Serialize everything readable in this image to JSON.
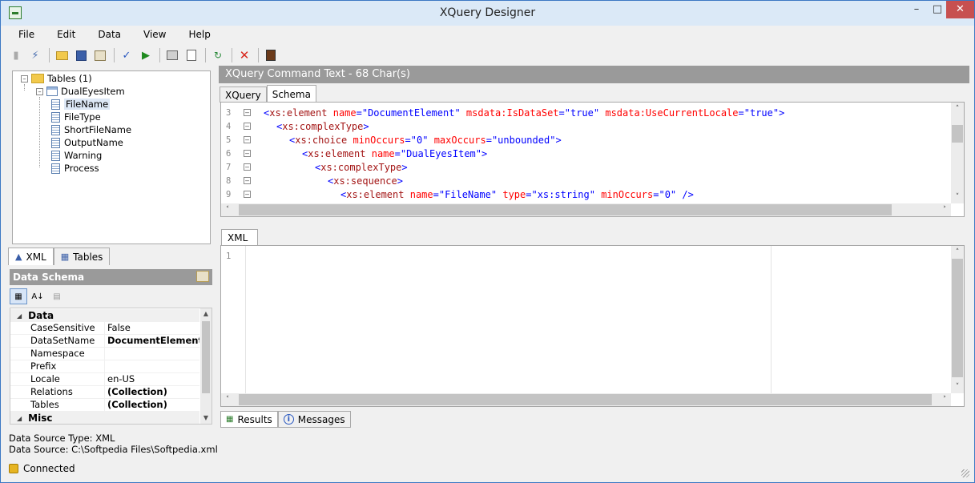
{
  "window": {
    "title": "XQuery Designer"
  },
  "menu": {
    "items": [
      "File",
      "Edit",
      "Data",
      "View",
      "Help"
    ]
  },
  "toolbar": {
    "icons": [
      "connect-icon",
      "disconnect-icon",
      "open-icon",
      "save-icon",
      "properties-icon",
      "validate-icon",
      "run-icon",
      "print-icon",
      "print-preview-icon",
      "refresh-icon",
      "delete-icon",
      "export-icon"
    ]
  },
  "tree": {
    "root": "Tables (1)",
    "table": "DualEyesItem",
    "columns": [
      "FileName",
      "FileType",
      "ShortFileName",
      "OutputName",
      "Warning",
      "Process"
    ],
    "selected": "FileName"
  },
  "left_tabs": {
    "xml": "XML",
    "tables": "Tables"
  },
  "schema_panel": {
    "title": "Data Schema",
    "categories": {
      "data": "Data",
      "misc": "Misc"
    },
    "properties": [
      {
        "name": "CaseSensitive",
        "value": "False",
        "bold": false
      },
      {
        "name": "DataSetName",
        "value": "DocumentElement",
        "bold": true
      },
      {
        "name": "Namespace",
        "value": "",
        "bold": false
      },
      {
        "name": "Prefix",
        "value": "",
        "bold": false
      },
      {
        "name": "Locale",
        "value": "en-US",
        "bold": false
      },
      {
        "name": "Relations",
        "value": "(Collection)",
        "bold": true
      },
      {
        "name": "Tables",
        "value": "(Collection)",
        "bold": true
      }
    ]
  },
  "status": {
    "source_type": "Data Source Type: XML",
    "source": "Data Source: C:\\Softpedia Files\\Softpedia.xml",
    "connection": "Connected"
  },
  "command": {
    "header": "XQuery Command Text - 68 Char(s)",
    "tabs": {
      "xquery": "XQuery",
      "schema": "Schema"
    },
    "lines": [
      {
        "n": "3",
        "indent": 0,
        "parts": [
          [
            "br",
            "<"
          ],
          [
            "tag",
            "xs:element"
          ],
          [
            "sp",
            " "
          ],
          [
            "attr",
            "name"
          ],
          [
            "br",
            "="
          ],
          [
            "val",
            "\"DocumentElement\""
          ],
          [
            "sp",
            " "
          ],
          [
            "attr",
            "msdata:IsDataSet"
          ],
          [
            "br",
            "="
          ],
          [
            "val",
            "\"true\""
          ],
          [
            "sp",
            " "
          ],
          [
            "attr",
            "msdata:UseCurrentLocale"
          ],
          [
            "br",
            "="
          ],
          [
            "val",
            "\"true\""
          ],
          [
            "br",
            ">"
          ]
        ]
      },
      {
        "n": "4",
        "indent": 1,
        "parts": [
          [
            "br",
            "<"
          ],
          [
            "tag",
            "xs:complexType"
          ],
          [
            "br",
            ">"
          ]
        ]
      },
      {
        "n": "5",
        "indent": 2,
        "parts": [
          [
            "br",
            "<"
          ],
          [
            "tag",
            "xs:choice"
          ],
          [
            "sp",
            " "
          ],
          [
            "attr",
            "minOccurs"
          ],
          [
            "br",
            "="
          ],
          [
            "val",
            "\"0\""
          ],
          [
            "sp",
            " "
          ],
          [
            "attr",
            "maxOccurs"
          ],
          [
            "br",
            "="
          ],
          [
            "val",
            "\"unbounded\""
          ],
          [
            "br",
            ">"
          ]
        ]
      },
      {
        "n": "6",
        "indent": 3,
        "parts": [
          [
            "br",
            "<"
          ],
          [
            "tag",
            "xs:element"
          ],
          [
            "sp",
            " "
          ],
          [
            "attr",
            "name"
          ],
          [
            "br",
            "="
          ],
          [
            "val",
            "\"DualEyesItem\""
          ],
          [
            "br",
            ">"
          ]
        ]
      },
      {
        "n": "7",
        "indent": 4,
        "parts": [
          [
            "br",
            "<"
          ],
          [
            "tag",
            "xs:complexType"
          ],
          [
            "br",
            ">"
          ]
        ]
      },
      {
        "n": "8",
        "indent": 5,
        "parts": [
          [
            "br",
            "<"
          ],
          [
            "tag",
            "xs:sequence"
          ],
          [
            "br",
            ">"
          ]
        ]
      },
      {
        "n": "9",
        "indent": 6,
        "parts": [
          [
            "br",
            "<"
          ],
          [
            "tag",
            "xs:element"
          ],
          [
            "sp",
            " "
          ],
          [
            "attr",
            "name"
          ],
          [
            "br",
            "="
          ],
          [
            "val",
            "\"FileName\""
          ],
          [
            "sp",
            " "
          ],
          [
            "attr",
            "type"
          ],
          [
            "br",
            "="
          ],
          [
            "val",
            "\"xs:string\""
          ],
          [
            "sp",
            " "
          ],
          [
            "attr",
            "minOccurs"
          ],
          [
            "br",
            "="
          ],
          [
            "val",
            "\"0\""
          ],
          [
            "sp",
            " "
          ],
          [
            "br",
            "/>"
          ]
        ]
      }
    ]
  },
  "xml_editor": {
    "tab": "XML",
    "line": "1"
  },
  "bottom_tabs": {
    "results": "Results",
    "messages": "Messages"
  },
  "colors": {
    "tag": "#a31515",
    "attr": "#ff0000",
    "value": "#0000ff",
    "header": "#9a9a9a",
    "titlebar": "#dbe9f7"
  }
}
